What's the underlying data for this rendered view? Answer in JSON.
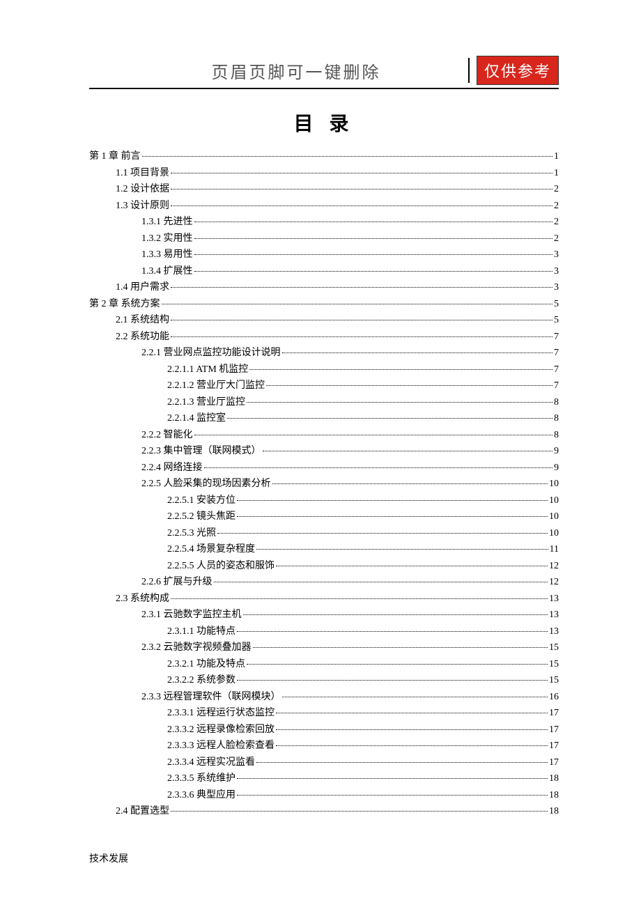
{
  "header": {
    "left_text": "页眉页脚可一键删除",
    "badge_text": "仅供参考"
  },
  "title": "目 录",
  "toc": [
    {
      "level": 0,
      "label": "第 1 章  前言",
      "page": "1"
    },
    {
      "level": 1,
      "label": "1.1  项目背景",
      "page": "1"
    },
    {
      "level": 1,
      "label": "1.2  设计依据",
      "page": "2"
    },
    {
      "level": 1,
      "label": "1.3  设计原则",
      "page": "2"
    },
    {
      "level": 2,
      "label": "1.3.1  先进性",
      "page": "2"
    },
    {
      "level": 2,
      "label": "1.3.2  实用性",
      "page": "2"
    },
    {
      "level": 2,
      "label": "1.3.3  易用性",
      "page": "3"
    },
    {
      "level": 2,
      "label": "1.3.4  扩展性",
      "page": "3"
    },
    {
      "level": 1,
      "label": "1.4  用户需求",
      "page": "3"
    },
    {
      "level": 0,
      "label": "第 2 章  系统方案",
      "page": "5"
    },
    {
      "level": 1,
      "label": "2.1  系统结构",
      "page": "5"
    },
    {
      "level": 1,
      "label": "2.2  系统功能",
      "page": "7"
    },
    {
      "level": 2,
      "label": "2.2.1  营业网点监控功能设计说明",
      "page": "7"
    },
    {
      "level": 3,
      "label": "2.2.1.1 ATM 机监控",
      "page": "7"
    },
    {
      "level": 3,
      "label": "2.2.1.2  营业厅大门监控",
      "page": "7"
    },
    {
      "level": 3,
      "label": "2.2.1.3  营业厅监控",
      "page": "8"
    },
    {
      "level": 3,
      "label": "2.2.1.4  监控室",
      "page": "8"
    },
    {
      "level": 2,
      "label": "2.2.2  智能化",
      "page": "8"
    },
    {
      "level": 2,
      "label": "2.2.3  集中管理（联网模式）",
      "page": "9"
    },
    {
      "level": 2,
      "label": "2.2.4  网络连接",
      "page": "9"
    },
    {
      "level": 2,
      "label": "2.2.5  人脸采集的现场因素分析",
      "page": "10"
    },
    {
      "level": 3,
      "label": "2.2.5.1  安装方位",
      "page": "10"
    },
    {
      "level": 3,
      "label": "2.2.5.2  镜头焦距",
      "page": "10"
    },
    {
      "level": 3,
      "label": "2.2.5.3  光照",
      "page": "10"
    },
    {
      "level": 3,
      "label": "2.2.5.4  场景复杂程度",
      "page": "11"
    },
    {
      "level": 3,
      "label": "2.2.5.5  人员的姿态和服饰",
      "page": "12"
    },
    {
      "level": 2,
      "label": "2.2.6  扩展与升级",
      "page": "12"
    },
    {
      "level": 1,
      "label": "2.3  系统构成",
      "page": "13"
    },
    {
      "level": 2,
      "label": "2.3.1  云驰数字监控主机",
      "page": "13"
    },
    {
      "level": 3,
      "label": "2.3.1.1  功能特点",
      "page": "13"
    },
    {
      "level": 2,
      "label": "2.3.2  云驰数字视频叠加器",
      "page": "15"
    },
    {
      "level": 3,
      "label": "2.3.2.1  功能及特点",
      "page": "15"
    },
    {
      "level": 3,
      "label": "2.3.2.2  系统参数",
      "page": "15"
    },
    {
      "level": 2,
      "label": "2.3.3  远程管理软件（联网模块）",
      "page": "16"
    },
    {
      "level": 3,
      "label": "2.3.3.1  远程运行状态监控",
      "page": "17"
    },
    {
      "level": 3,
      "label": "2.3.3.2  远程录像检索回放",
      "page": "17"
    },
    {
      "level": 3,
      "label": "2.3.3.3  远程人脸检索查看",
      "page": "17"
    },
    {
      "level": 3,
      "label": "2.3.3.4  远程实况监看",
      "page": "17"
    },
    {
      "level": 3,
      "label": "2.3.3.5  系统维护",
      "page": "18"
    },
    {
      "level": 3,
      "label": "2.3.3.6  典型应用",
      "page": "18"
    },
    {
      "level": 1,
      "label": "2.4  配置选型",
      "page": "18"
    }
  ],
  "footer": "技术发展"
}
